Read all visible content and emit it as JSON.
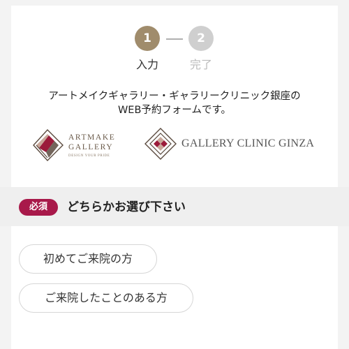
{
  "steps": [
    {
      "number": "1",
      "label": "入力",
      "state": "active",
      "color": "#a08c6c"
    },
    {
      "number": "2",
      "label": "完了",
      "state": "inactive",
      "color": "#cfcfcf"
    }
  ],
  "intro": {
    "line1": "アートメイクギャラリー・ギャラリークリニック銀座の",
    "line2": "WEB予約フォームです。"
  },
  "logos": {
    "artmake": {
      "line1": "ARTMAKE",
      "line2": "GALLERY",
      "subtitle": "DESIGN YOUR PRIDE"
    },
    "clinic": {
      "name": "GALLERY CLINIC GINZA"
    }
  },
  "question": {
    "badge": "必須",
    "badge_color": "#a8194a",
    "title": "どちらかお選び下さい",
    "options": [
      "初めてご来院の方",
      "ご来院したことのある方"
    ]
  }
}
